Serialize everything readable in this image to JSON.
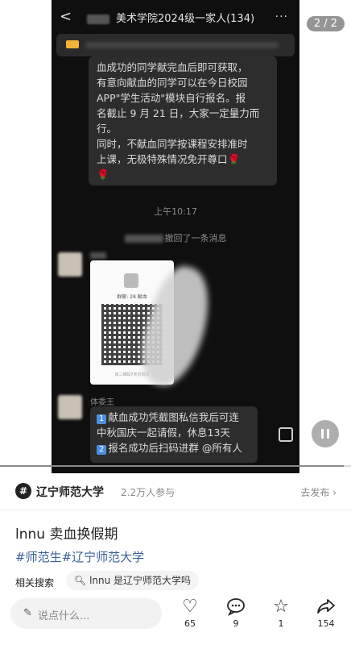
{
  "page_indicator": "2 / 2",
  "chat": {
    "back_glyph": "<",
    "title": "美术学院2024级一家人(134)",
    "more_glyph": "···",
    "message1_lines": [
      "血成功的同学献完血后即可获取，",
      "有意向献血的同学可以在今日校园",
      "APP\"学生活动\"模块自行报名。报",
      "名截止 9 月 21 日，大家一定量力而",
      "行。",
      "同时，不献血同学按课程安排准时",
      "上课，无极特殊情况免开尊口"
    ],
    "flower": "🌹",
    "time": "上午10:17",
    "recalled_text": "撤回了一条消息",
    "sender_name": "体委王",
    "qr_card_name": "群聊: 28 献血",
    "qr_card_footer": "该二维码7天内有效",
    "message2_lines": [
      {
        "num": "1",
        "text": "献血成功凭截图私信我后可连"
      },
      {
        "num": "",
        "text": "中秋国庆一起请假，休息13天"
      },
      {
        "num": "2",
        "text": "报名成功后扫码进群 @所有人"
      }
    ]
  },
  "video": {
    "progress": 0.98
  },
  "topic": {
    "logo": "#",
    "name": "辽宁师范大学",
    "participants": "2.2万人参与",
    "post_link": "去发布 ›"
  },
  "post": {
    "title": "lnnu 卖血换假期",
    "hashtags": "#师范生#辽宁师范大学"
  },
  "related": {
    "label": "相关搜索",
    "query": "lnnu 是辽宁师范大学吗"
  },
  "comment_box": {
    "placeholder": "说点什么..."
  },
  "actions": {
    "likes": "65",
    "comments": "9",
    "favorites": "1",
    "shares": "154"
  },
  "icons": {
    "pen": "pen-icon",
    "search": "search-icon",
    "heart": "heart-icon",
    "chat": "comment-icon",
    "star": "star-icon",
    "share": "share-icon",
    "pause": "pause-icon"
  },
  "colors": {
    "hashtag": "#3b5f9b",
    "chat_bg": "#0f0f0f",
    "bubble": "#2d2d2d",
    "pin_icon": "#f3b23a"
  }
}
